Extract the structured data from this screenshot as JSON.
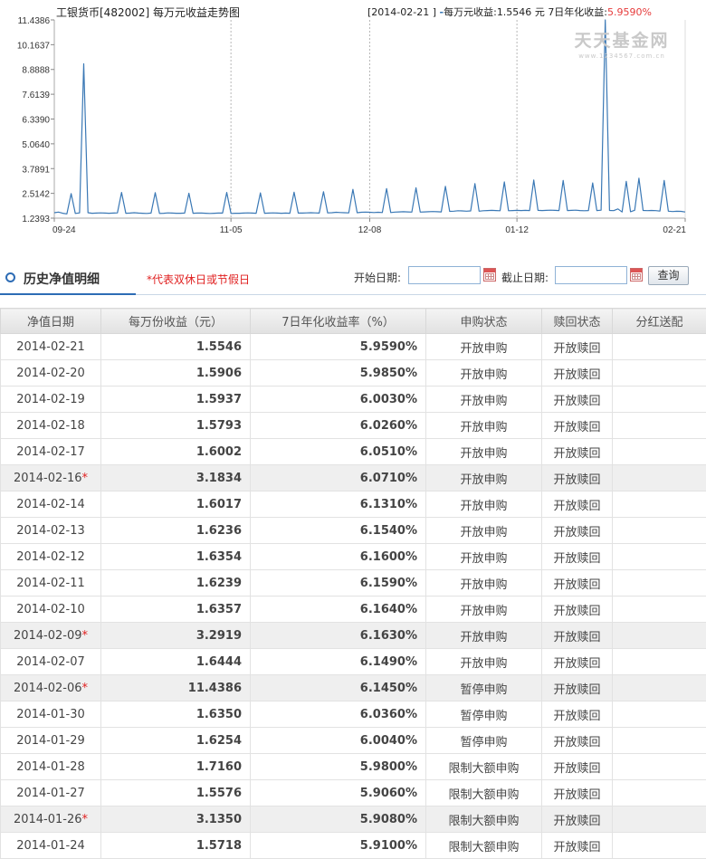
{
  "chart": {
    "title": "工银货币[482002] 每万元收益走势图",
    "info_date": "[2014-02-21 ]",
    "info_label": "每万元收益:",
    "info_value": "1.5546",
    "info_unit": "元",
    "info_rate_label": "7日年化收益:",
    "info_rate": "5.9590%",
    "watermark_main": "天天基金网",
    "watermark_sub": "www.1234567.com.cn"
  },
  "chart_data": {
    "type": "line",
    "title": "工银货币[482002] 每万元收益走势图",
    "yticks": [
      "11.4386",
      "10.1637",
      "8.8888",
      "7.6139",
      "6.3390",
      "5.0640",
      "3.7891",
      "2.5142",
      "1.2393"
    ],
    "ylim": [
      1.2393,
      11.4386
    ],
    "xticks": [
      "09-24",
      "11-05",
      "12-08",
      "01-12",
      "02-21"
    ],
    "xtick_index": [
      0,
      42,
      75,
      110,
      150
    ],
    "grid": true,
    "series": [
      {
        "values": [
          1.52,
          1.55,
          1.49,
          1.46,
          2.5,
          1.48,
          1.51,
          9.18,
          1.52,
          1.49,
          1.5,
          1.51,
          1.5,
          1.49,
          1.5,
          1.51,
          2.56,
          1.49,
          1.5,
          1.52,
          1.5,
          1.49,
          1.48,
          1.5,
          2.55,
          1.48,
          1.49,
          1.51,
          1.5,
          1.49,
          1.49,
          1.5,
          2.52,
          1.49,
          1.5,
          1.5,
          1.49,
          1.48,
          1.49,
          1.5,
          1.5,
          2.56,
          1.48,
          1.49,
          1.49,
          1.5,
          1.51,
          1.5,
          1.49,
          2.54,
          1.49,
          1.5,
          1.51,
          1.5,
          1.49,
          1.5,
          1.49,
          2.57,
          1.5,
          1.5,
          1.51,
          1.52,
          1.51,
          1.5,
          2.6,
          1.51,
          1.52,
          1.54,
          1.53,
          1.52,
          1.51,
          2.72,
          1.52,
          1.54,
          1.55,
          1.54,
          1.53,
          1.54,
          1.53,
          2.76,
          1.53,
          1.55,
          1.56,
          1.57,
          1.56,
          1.55,
          2.8,
          1.55,
          1.56,
          1.57,
          1.58,
          1.57,
          1.56,
          2.88,
          1.59,
          1.6,
          1.62,
          1.61,
          1.6,
          1.61,
          3.02,
          1.6,
          1.62,
          1.63,
          1.64,
          1.63,
          1.62,
          3.1,
          1.62,
          1.63,
          1.64,
          1.63,
          1.64,
          1.63,
          3.2,
          1.64,
          1.63,
          1.64,
          1.65,
          1.64,
          1.63,
          3.18,
          1.63,
          1.64,
          1.65,
          1.63,
          1.62,
          1.63,
          3.05,
          1.63,
          1.65,
          11.4386,
          1.635,
          1.625,
          1.716,
          1.5576,
          3.135,
          1.5718,
          1.6444,
          3.2919,
          1.6357,
          1.6239,
          1.6354,
          1.6236,
          1.6017,
          3.1834,
          1.6002,
          1.5793,
          1.5937,
          1.5906,
          1.5546
        ]
      }
    ]
  },
  "toolbar": {
    "section_title": "历史净值明细",
    "holiday_note": "*代表双休日或节假日",
    "start_label": "开始日期:",
    "start_value": "",
    "end_label": "截止日期:",
    "end_value": "",
    "query_label": "查询"
  },
  "table": {
    "headers": [
      "净值日期",
      "每万份收益（元）",
      "7日年化收益率（%）",
      "申购状态",
      "赎回状态",
      "分红送配"
    ],
    "rows": [
      {
        "date": "2014-02-21",
        "star": "",
        "val": "1.5546",
        "rate": "5.9590%",
        "buy": "开放申购",
        "redeem": "开放赎回",
        "div": ""
      },
      {
        "date": "2014-02-20",
        "star": "",
        "val": "1.5906",
        "rate": "5.9850%",
        "buy": "开放申购",
        "redeem": "开放赎回",
        "div": ""
      },
      {
        "date": "2014-02-19",
        "star": "",
        "val": "1.5937",
        "rate": "6.0030%",
        "buy": "开放申购",
        "redeem": "开放赎回",
        "div": ""
      },
      {
        "date": "2014-02-18",
        "star": "",
        "val": "1.5793",
        "rate": "6.0260%",
        "buy": "开放申购",
        "redeem": "开放赎回",
        "div": ""
      },
      {
        "date": "2014-02-17",
        "star": "",
        "val": "1.6002",
        "rate": "6.0510%",
        "buy": "开放申购",
        "redeem": "开放赎回",
        "div": ""
      },
      {
        "date": "2014-02-16",
        "star": "*",
        "val": "3.1834",
        "rate": "6.0710%",
        "buy": "开放申购",
        "redeem": "开放赎回",
        "div": ""
      },
      {
        "date": "2014-02-14",
        "star": "",
        "val": "1.6017",
        "rate": "6.1310%",
        "buy": "开放申购",
        "redeem": "开放赎回",
        "div": ""
      },
      {
        "date": "2014-02-13",
        "star": "",
        "val": "1.6236",
        "rate": "6.1540%",
        "buy": "开放申购",
        "redeem": "开放赎回",
        "div": ""
      },
      {
        "date": "2014-02-12",
        "star": "",
        "val": "1.6354",
        "rate": "6.1600%",
        "buy": "开放申购",
        "redeem": "开放赎回",
        "div": ""
      },
      {
        "date": "2014-02-11",
        "star": "",
        "val": "1.6239",
        "rate": "6.1590%",
        "buy": "开放申购",
        "redeem": "开放赎回",
        "div": ""
      },
      {
        "date": "2014-02-10",
        "star": "",
        "val": "1.6357",
        "rate": "6.1640%",
        "buy": "开放申购",
        "redeem": "开放赎回",
        "div": ""
      },
      {
        "date": "2014-02-09",
        "star": "*",
        "val": "3.2919",
        "rate": "6.1630%",
        "buy": "开放申购",
        "redeem": "开放赎回",
        "div": ""
      },
      {
        "date": "2014-02-07",
        "star": "",
        "val": "1.6444",
        "rate": "6.1490%",
        "buy": "开放申购",
        "redeem": "开放赎回",
        "div": ""
      },
      {
        "date": "2014-02-06",
        "star": "*",
        "val": "11.4386",
        "rate": "6.1450%",
        "buy": "暂停申购",
        "redeem": "开放赎回",
        "div": ""
      },
      {
        "date": "2014-01-30",
        "star": "",
        "val": "1.6350",
        "rate": "6.0360%",
        "buy": "暂停申购",
        "redeem": "开放赎回",
        "div": ""
      },
      {
        "date": "2014-01-29",
        "star": "",
        "val": "1.6254",
        "rate": "6.0040%",
        "buy": "暂停申购",
        "redeem": "开放赎回",
        "div": ""
      },
      {
        "date": "2014-01-28",
        "star": "",
        "val": "1.7160",
        "rate": "5.9800%",
        "buy": "限制大额申购",
        "redeem": "开放赎回",
        "div": ""
      },
      {
        "date": "2014-01-27",
        "star": "",
        "val": "1.5576",
        "rate": "5.9060%",
        "buy": "限制大额申购",
        "redeem": "开放赎回",
        "div": ""
      },
      {
        "date": "2014-01-26",
        "star": "*",
        "val": "3.1350",
        "rate": "5.9080%",
        "buy": "限制大额申购",
        "redeem": "开放赎回",
        "div": ""
      },
      {
        "date": "2014-01-24",
        "star": "",
        "val": "1.5718",
        "rate": "5.9100%",
        "buy": "限制大额申购",
        "redeem": "开放赎回",
        "div": ""
      }
    ]
  },
  "colors": {
    "line": "#3a78b5",
    "rate": "#e63b3b",
    "holiday_star": "#e02020",
    "tab_accent": "#2d6cb5"
  }
}
